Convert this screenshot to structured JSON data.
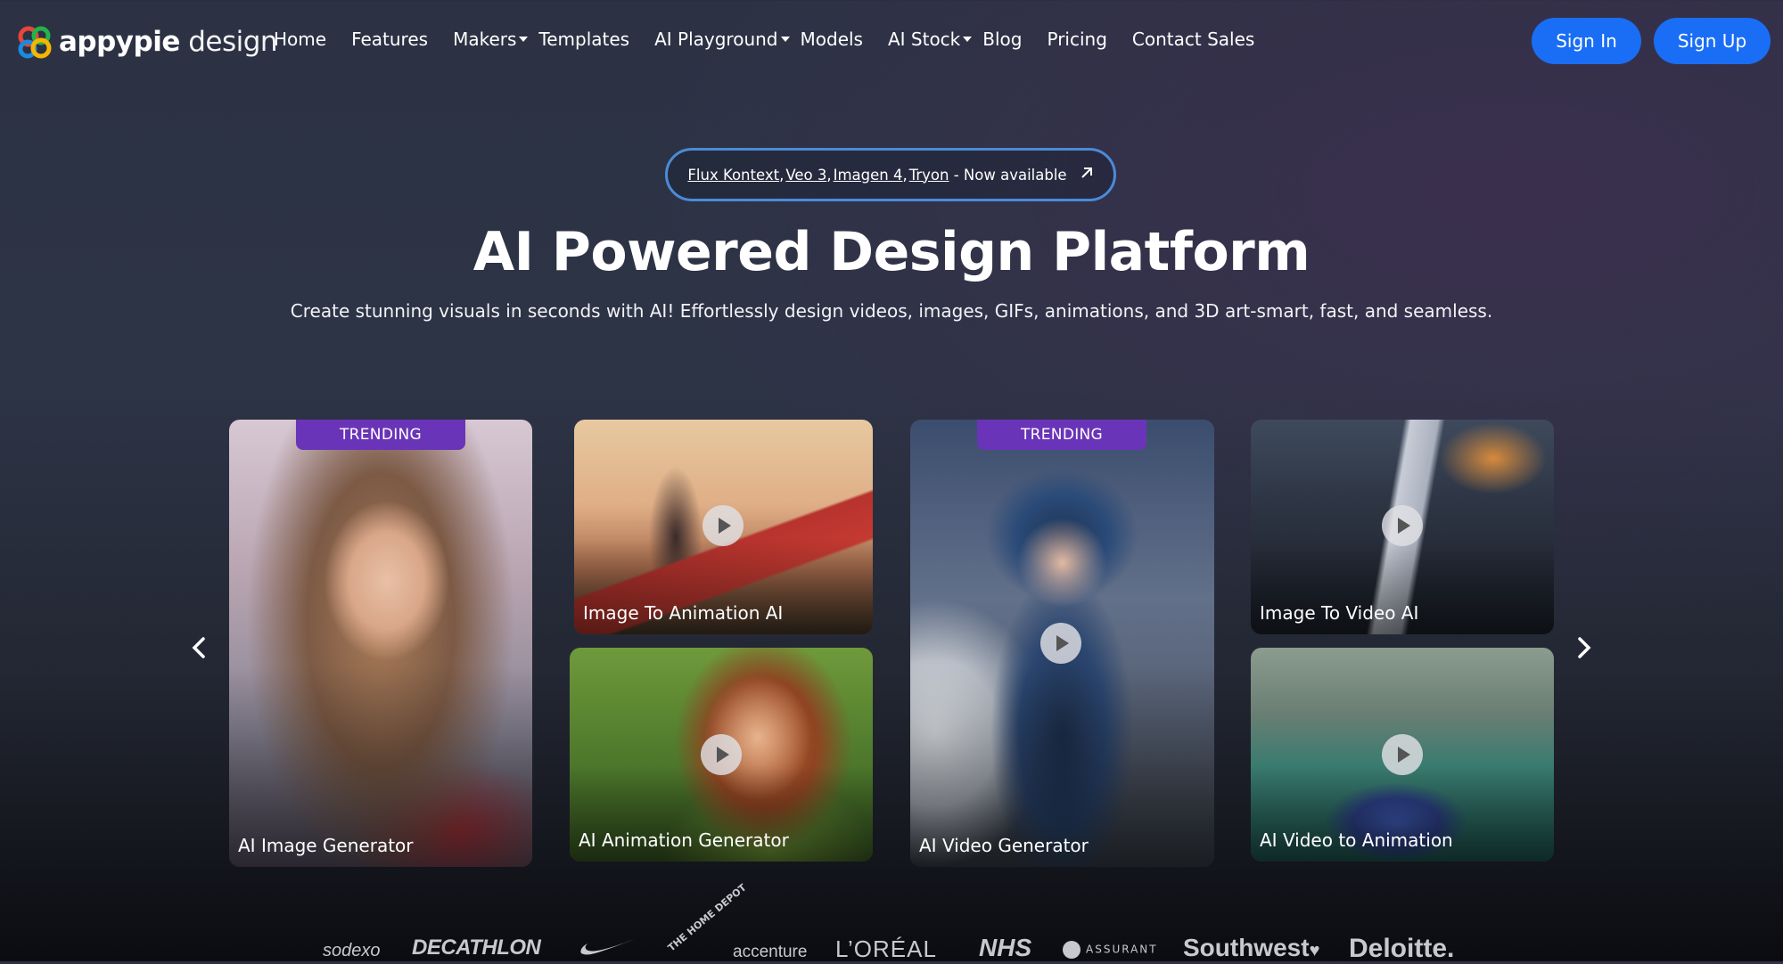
{
  "brand": {
    "name_bold": "appypie",
    "name_rest": " design"
  },
  "nav": {
    "items": [
      {
        "label": "Home",
        "dropdown": false
      },
      {
        "label": "Features",
        "dropdown": false
      },
      {
        "label": "Makers",
        "dropdown": true
      },
      {
        "label": "Templates",
        "dropdown": false
      },
      {
        "label": "AI Playground",
        "dropdown": true
      },
      {
        "label": "Models",
        "dropdown": false
      },
      {
        "label": "AI Stock",
        "dropdown": true
      },
      {
        "label": "Blog",
        "dropdown": false
      },
      {
        "label": "Pricing",
        "dropdown": false
      },
      {
        "label": "Contact Sales",
        "dropdown": false
      }
    ],
    "sign_in": "Sign In",
    "sign_up": "Sign Up"
  },
  "announcement": {
    "links": [
      "Flux Kontext",
      "Veo 3",
      "Imagen 4",
      "Tryon"
    ],
    "separator": ",",
    "suffix": " - Now available",
    "arrow_icon": "arrow-up-right-icon"
  },
  "hero": {
    "title": "AI Powered Design Platform",
    "subtitle": "Create stunning visuals in seconds with AI! Effortlessly design videos, images, GIFs, animations, and 3D art-smart, fast, and seamless."
  },
  "carousel": {
    "prev_icon": "chevron-left-icon",
    "next_icon": "chevron-right-icon",
    "cards": [
      {
        "label": "AI Image Generator",
        "badge": "TRENDING",
        "video": false
      },
      {
        "label": "Image To Animation AI",
        "badge": "",
        "video": true
      },
      {
        "label": "AI Animation Generator",
        "badge": "",
        "video": true
      },
      {
        "label": "AI Video Generator",
        "badge": "TRENDING",
        "video": true
      },
      {
        "label": "Image To Video AI",
        "badge": "",
        "video": true
      },
      {
        "label": "AI Video to Animation",
        "badge": "",
        "video": true
      }
    ]
  },
  "logos": [
    "sodexo",
    "DECATHLON",
    "nike-swoosh",
    "THE HOME DEPOT",
    "accenture",
    "L'ORÉAL",
    "NHS",
    "ASSURANT",
    "Southwest",
    "Deloitte."
  ],
  "logo_text": {
    "sodexo": "sodexo",
    "decathlon": "DECATHLON",
    "homedepot": "THE HOME DEPOT",
    "accenture": "accenture",
    "loreal": "L’ORÉAL",
    "nhs": "NHS",
    "assurant": "ASSURANT",
    "southwest": "Southwest",
    "deloitte": "Deloitte."
  },
  "colors": {
    "accent_blue": "#1a6ef5",
    "badge_purple": "#6a34b8",
    "announce_border": "#4a8bd8"
  }
}
